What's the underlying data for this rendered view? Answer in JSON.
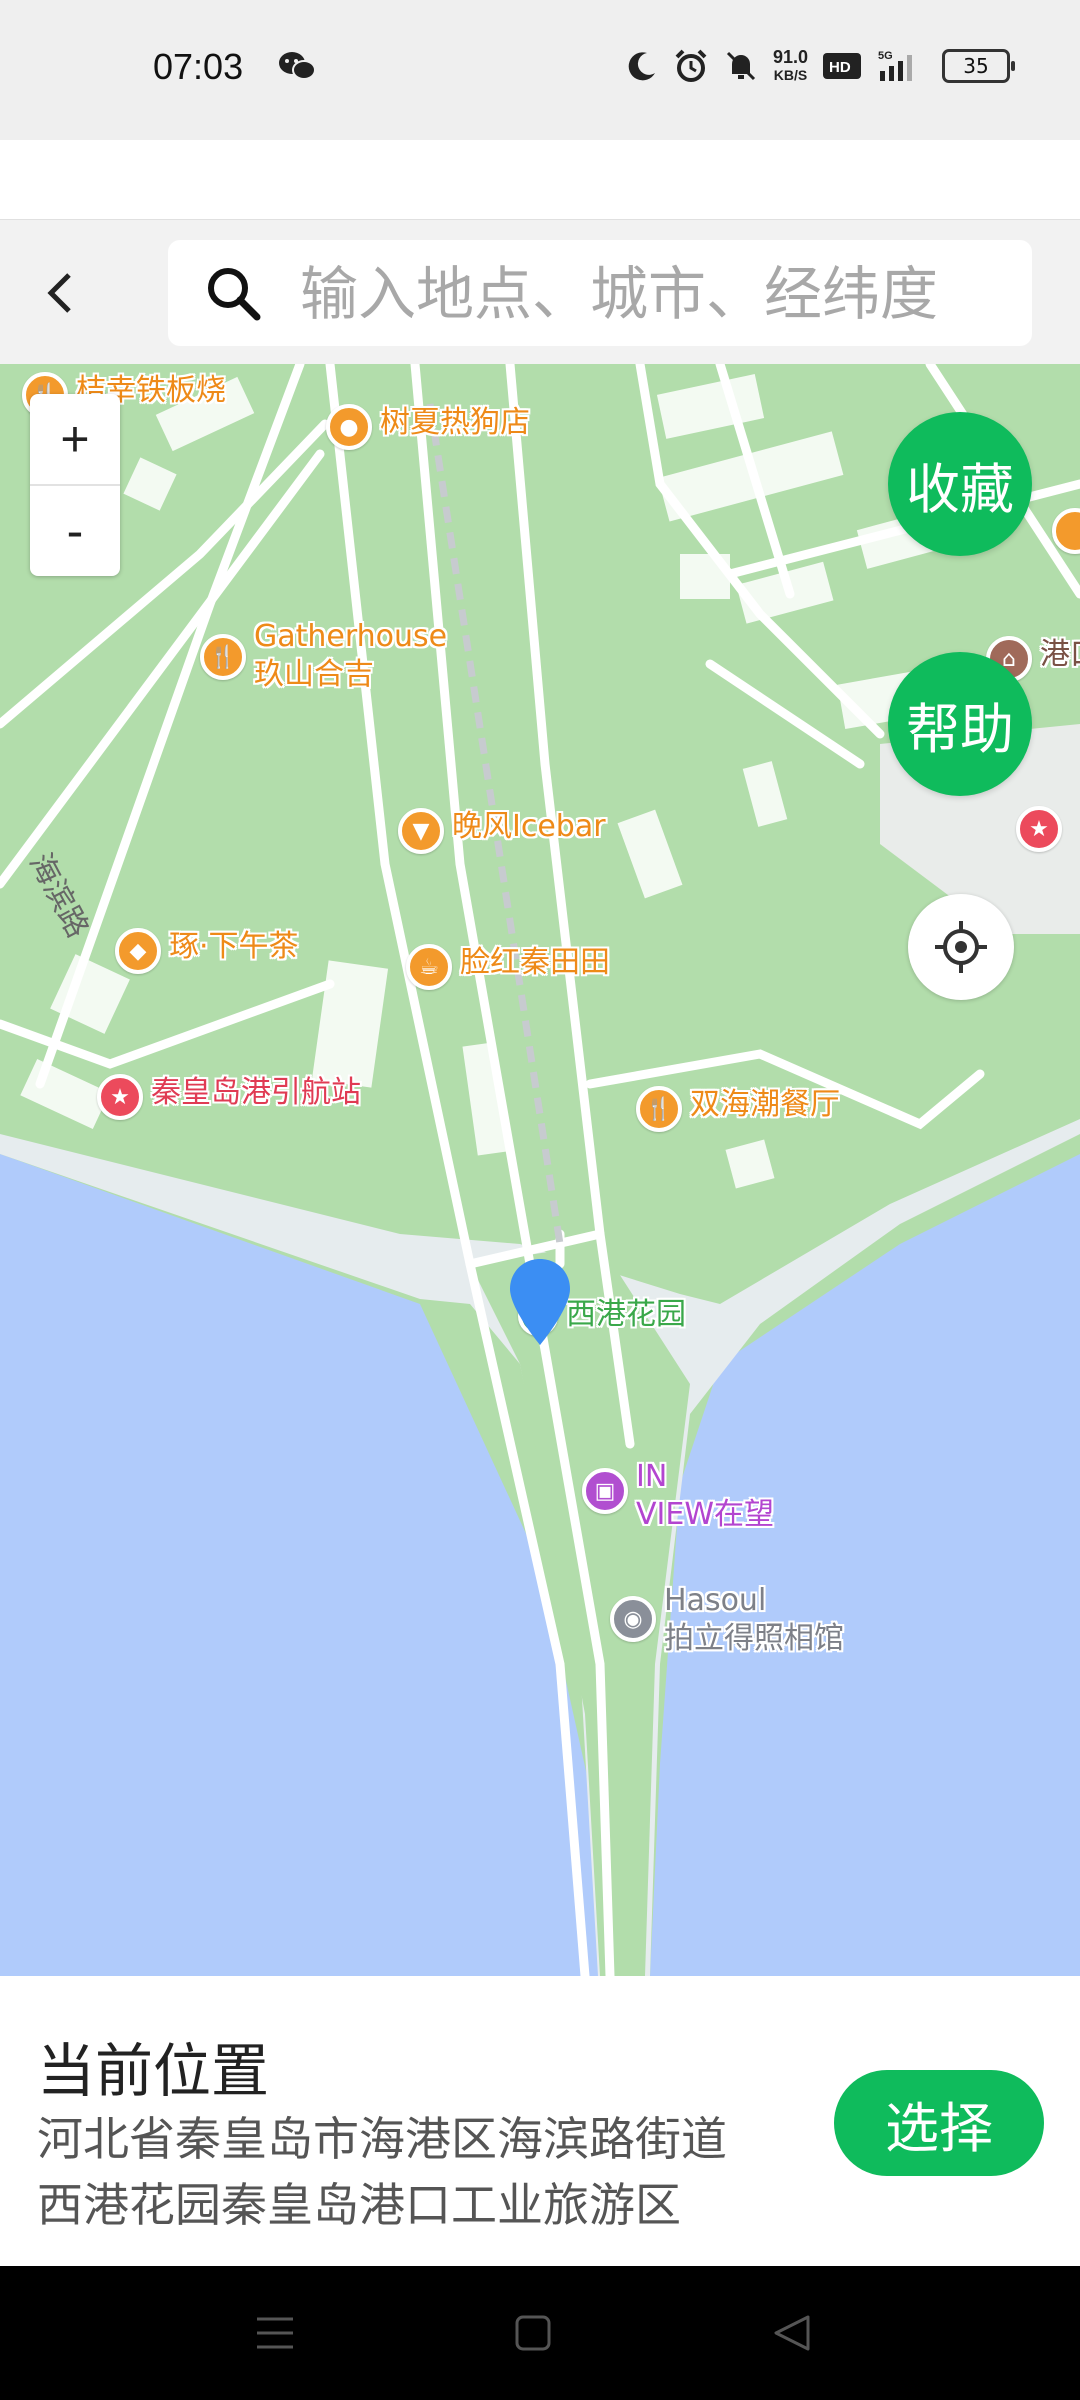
{
  "status_bar": {
    "time": "07:03",
    "net_speed_value": "91.0",
    "net_speed_unit": "KB/S",
    "hd_badge": "HD",
    "signal_label": "5G",
    "battery": "35",
    "icons": [
      "wechat-icon",
      "moon-icon",
      "alarm-icon",
      "mute-icon",
      "hd-icon",
      "signal-icon",
      "battery-icon"
    ]
  },
  "search": {
    "placeholder": "输入地点、城市、经纬度",
    "value": ""
  },
  "map": {
    "zoom_in": "+",
    "zoom_out": "-",
    "favorite_button": "收藏",
    "help_button": "帮助",
    "road_label": "海滨路",
    "pois": {
      "tiexin": "桔幸铁板烧",
      "hotdog": "树夏热狗店",
      "gatherhouse_1": "Gatherhouse",
      "gatherhouse_2": "玖山合吉",
      "icebar": "晚风Icebar",
      "afternoon_tea": "琢·下午茶",
      "lianhong": "脸红秦田田",
      "pilot_station": "秦皇岛港引航站",
      "shuanghai": "双海潮餐厅",
      "xigang": "西港花园",
      "inview_1": "IN",
      "inview_2": "VIEW在望",
      "hasoul_1": "Hasoul",
      "hasoul_2": "拍立得照相馆",
      "port_museum": "港口"
    },
    "colors": {
      "land": "#b2ddab",
      "water": "#b0cbfb",
      "road": "#ffffff",
      "accent_green": "#0fbb5c"
    }
  },
  "location_panel": {
    "title": "当前位置",
    "address_line1": "河北省秦皇岛市海港区海滨路街道",
    "address_line2": "西港花园秦皇岛港口工业旅游区",
    "select_button": "选择"
  },
  "nav_bar": {
    "icons": [
      "menu-icon",
      "home-icon",
      "back-triangle-icon"
    ]
  }
}
